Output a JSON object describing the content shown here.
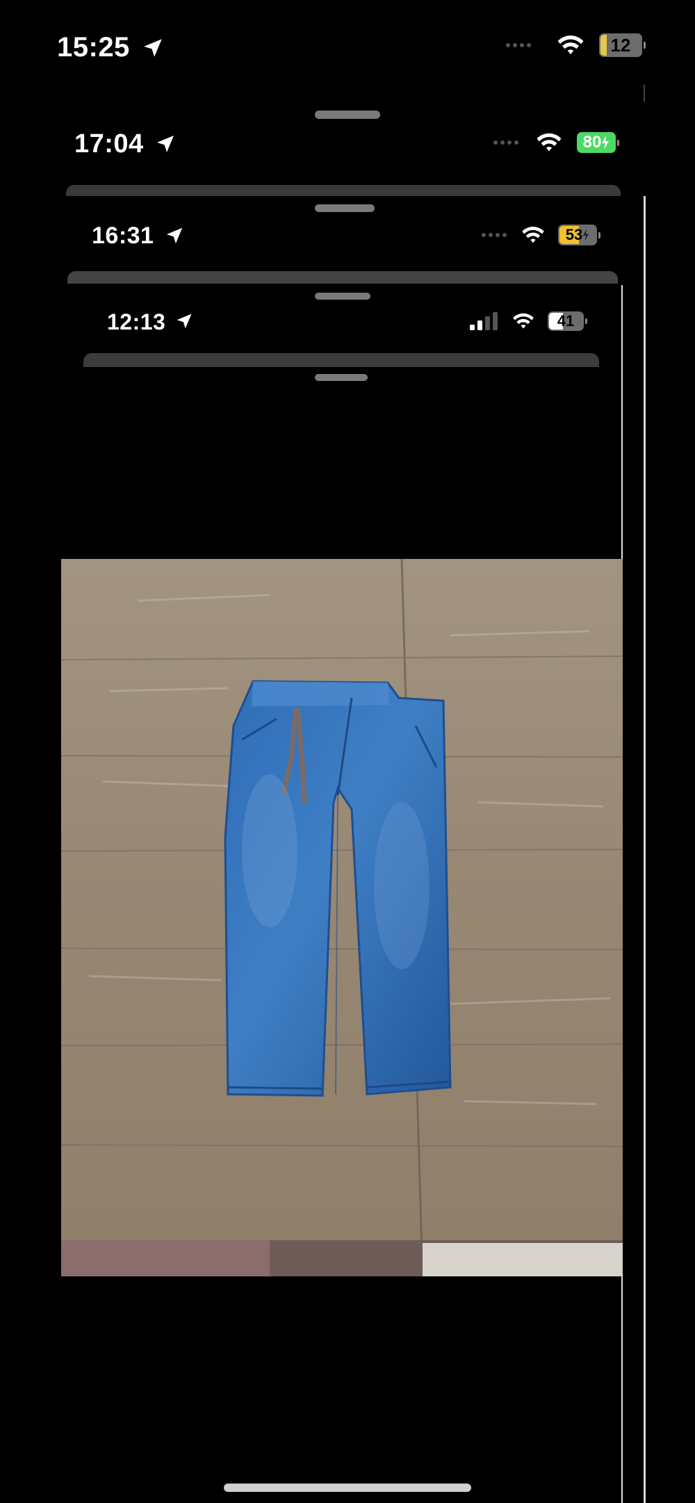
{
  "status_bars": [
    {
      "time": "15:25",
      "battery": "12",
      "battery_color": "#e6c84a"
    },
    {
      "time": "17:04",
      "battery": "80",
      "battery_color": "#4cd964"
    },
    {
      "time": "16:31",
      "battery": "53",
      "battery_color": "#f2c12e"
    },
    {
      "time": "12:13",
      "battery": "41",
      "battery_color": "#ffffff"
    }
  ],
  "icons": {
    "location": "location-arrow-icon",
    "wifi": "wifi-icon",
    "cellular": "cellular-signal-icon",
    "battery": "battery-icon",
    "charging": "charging-bolt-icon"
  },
  "photo": {
    "subject": "blue-denim-toddler-jeans"
  }
}
